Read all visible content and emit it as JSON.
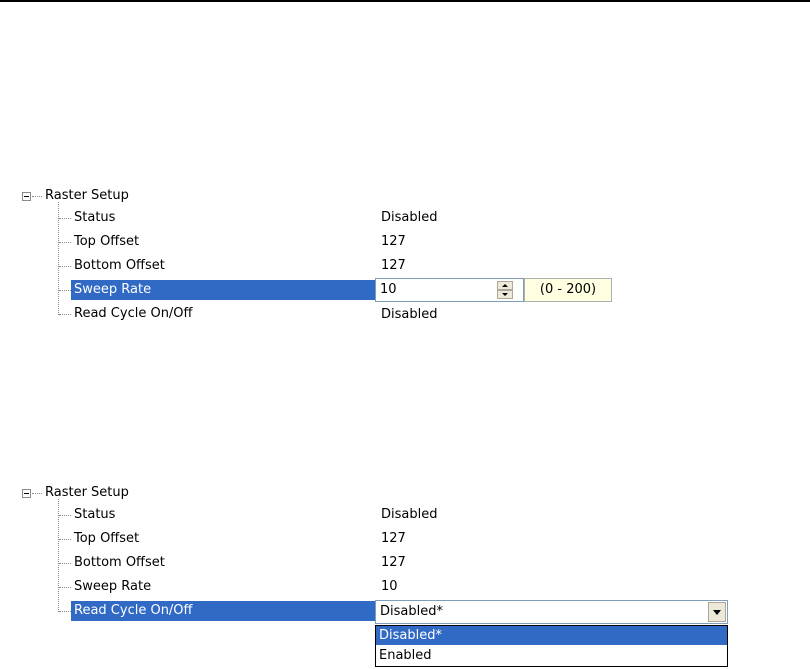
{
  "panel1": {
    "root_label": "Raster Setup",
    "items": [
      {
        "label": "Status",
        "value": "Disabled"
      },
      {
        "label": "Top Offset",
        "value": "127"
      },
      {
        "label": "Bottom Offset",
        "value": "127"
      },
      {
        "label": "Sweep Rate",
        "value": "10"
      },
      {
        "label": "Read Cycle On/Off",
        "value": "Disabled"
      }
    ],
    "editor_range": "(0 - 200)"
  },
  "panel2": {
    "root_label": "Raster Setup",
    "items": [
      {
        "label": "Status",
        "value": "Disabled"
      },
      {
        "label": "Top Offset",
        "value": "127"
      },
      {
        "label": "Bottom Offset",
        "value": "127"
      },
      {
        "label": "Sweep Rate",
        "value": "10"
      },
      {
        "label": "Read Cycle On/Off",
        "value": "Disabled*"
      }
    ],
    "dropdown_options": [
      "Disabled*",
      "Enabled"
    ]
  },
  "colors": {
    "selection": "#316ac5",
    "range_tip": "#ffffe1"
  }
}
